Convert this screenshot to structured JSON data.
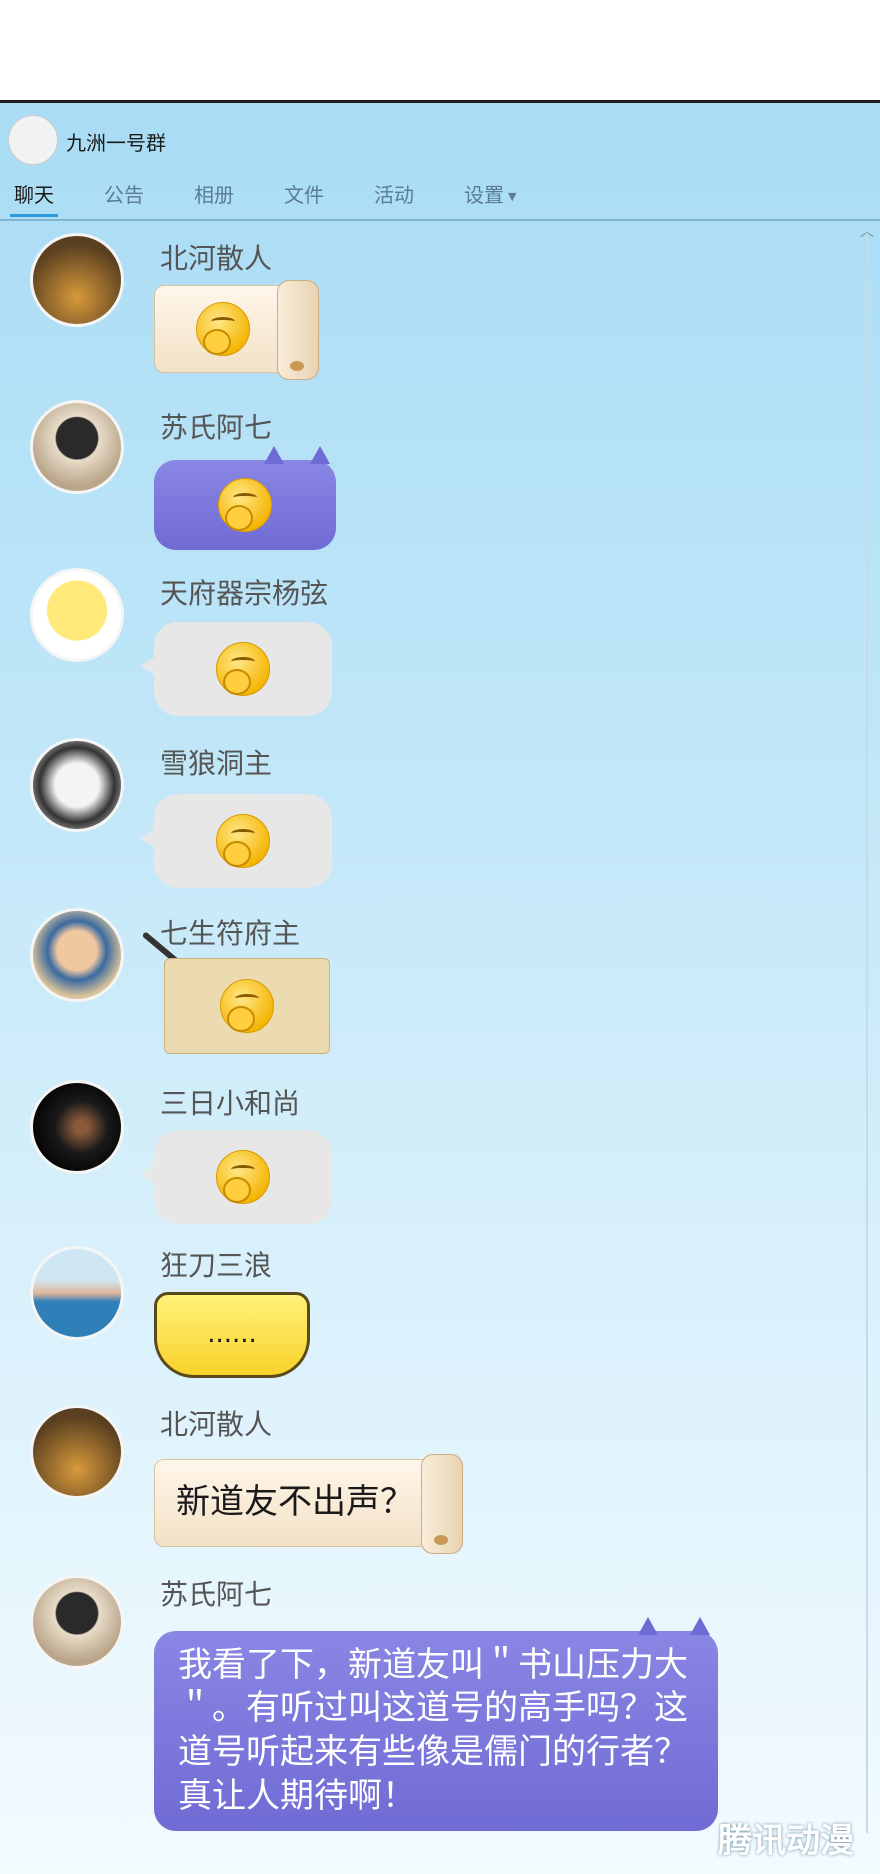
{
  "group": {
    "title": "九洲一号群"
  },
  "tabs": [
    {
      "label": "聊天"
    },
    {
      "label": "公告"
    },
    {
      "label": "相册"
    },
    {
      "label": "文件"
    },
    {
      "label": "活动"
    },
    {
      "label": "设置"
    }
  ],
  "messages": [
    {
      "sender": "北河散人",
      "content": "",
      "style": "paper"
    },
    {
      "sender": "苏氏阿七",
      "content": "",
      "style": "purple"
    },
    {
      "sender": "天府器宗杨弦",
      "content": "",
      "style": "grey"
    },
    {
      "sender": "雪狼洞主",
      "content": "",
      "style": "grey"
    },
    {
      "sender": "七生符府主",
      "content": "",
      "style": "parchment"
    },
    {
      "sender": "三日小和尚",
      "content": "",
      "style": "grey"
    },
    {
      "sender": "狂刀三浪",
      "content": "......",
      "style": "yellow"
    },
    {
      "sender": "北河散人",
      "content": "新道友不出声？",
      "style": "paper"
    },
    {
      "sender": "苏氏阿七",
      "content": "我看了下，新道友叫＂书山压力大＂。有听过叫这道号的高手吗？这道号听起来有些像是儒门的行者？真让人期待啊！",
      "style": "purple"
    }
  ],
  "watermark": "腾讯动漫",
  "colors": {
    "accent": "#2d9be0",
    "purple": "#7a76dc",
    "paper": "#f6e9d6",
    "grey": "#e7e7e7",
    "yellow": "#f8d22a"
  }
}
